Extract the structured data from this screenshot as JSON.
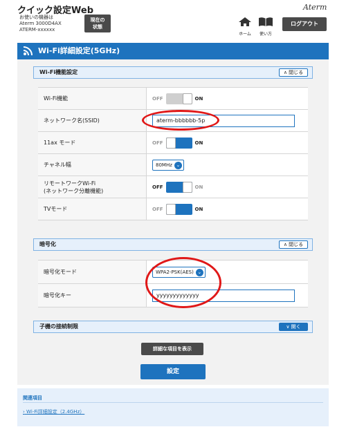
{
  "header": {
    "app_title": "クイック設定Web",
    "device_label": "お使いの機器は",
    "device_model": "Aterm 3000D4AX",
    "device_id": "ATERM-xxxxxx",
    "status_button": "現在の\n状態",
    "brand": "Aterm",
    "home_label": "ホーム",
    "manual_label": "使い方",
    "logout_button": "ログアウト"
  },
  "page": {
    "title": "Wi-Fi詳細設定(5GHz)"
  },
  "wifi_section": {
    "title": "Wi-Fi機能設定",
    "toggle_label": "閉じる",
    "rows": {
      "wifi_function": {
        "label": "Wi-Fi機能",
        "off": "OFF",
        "on": "ON",
        "state": "on-grey"
      },
      "ssid": {
        "label": "ネットワーク名(SSID)",
        "value": "aterm-bbbbbb-5p"
      },
      "ax_mode": {
        "label": "11ax モード",
        "off": "OFF",
        "on": "ON",
        "state": "on"
      },
      "channel_width": {
        "label": "チャネル幅",
        "value": "80MHz"
      },
      "remote_work": {
        "label_line1": "リモートワークWi-Fi",
        "label_line2": "(ネットワーク分離機能)",
        "off": "OFF",
        "on": "ON",
        "state": "off"
      },
      "tv_mode": {
        "label": "TVモード",
        "off": "OFF",
        "on": "ON",
        "state": "on"
      }
    }
  },
  "encryption_section": {
    "title": "暗号化",
    "toggle_label": "閉じる",
    "rows": {
      "mode": {
        "label": "暗号化モード",
        "value": "WPA2-PSK(AES)"
      },
      "key": {
        "label": "暗号化キー",
        "value": "yyyyyyyyyyyyy"
      }
    }
  },
  "client_section": {
    "title": "子機の接続制限",
    "toggle_label": "開く"
  },
  "buttons": {
    "detail": "詳細な項目を表示",
    "save": "設定"
  },
  "related": {
    "title": "関連項目",
    "link": "Wi-Fi詳細設定（2.4GHz）"
  },
  "colors": {
    "accent": "#1e73be",
    "annotation": "#e01818"
  }
}
